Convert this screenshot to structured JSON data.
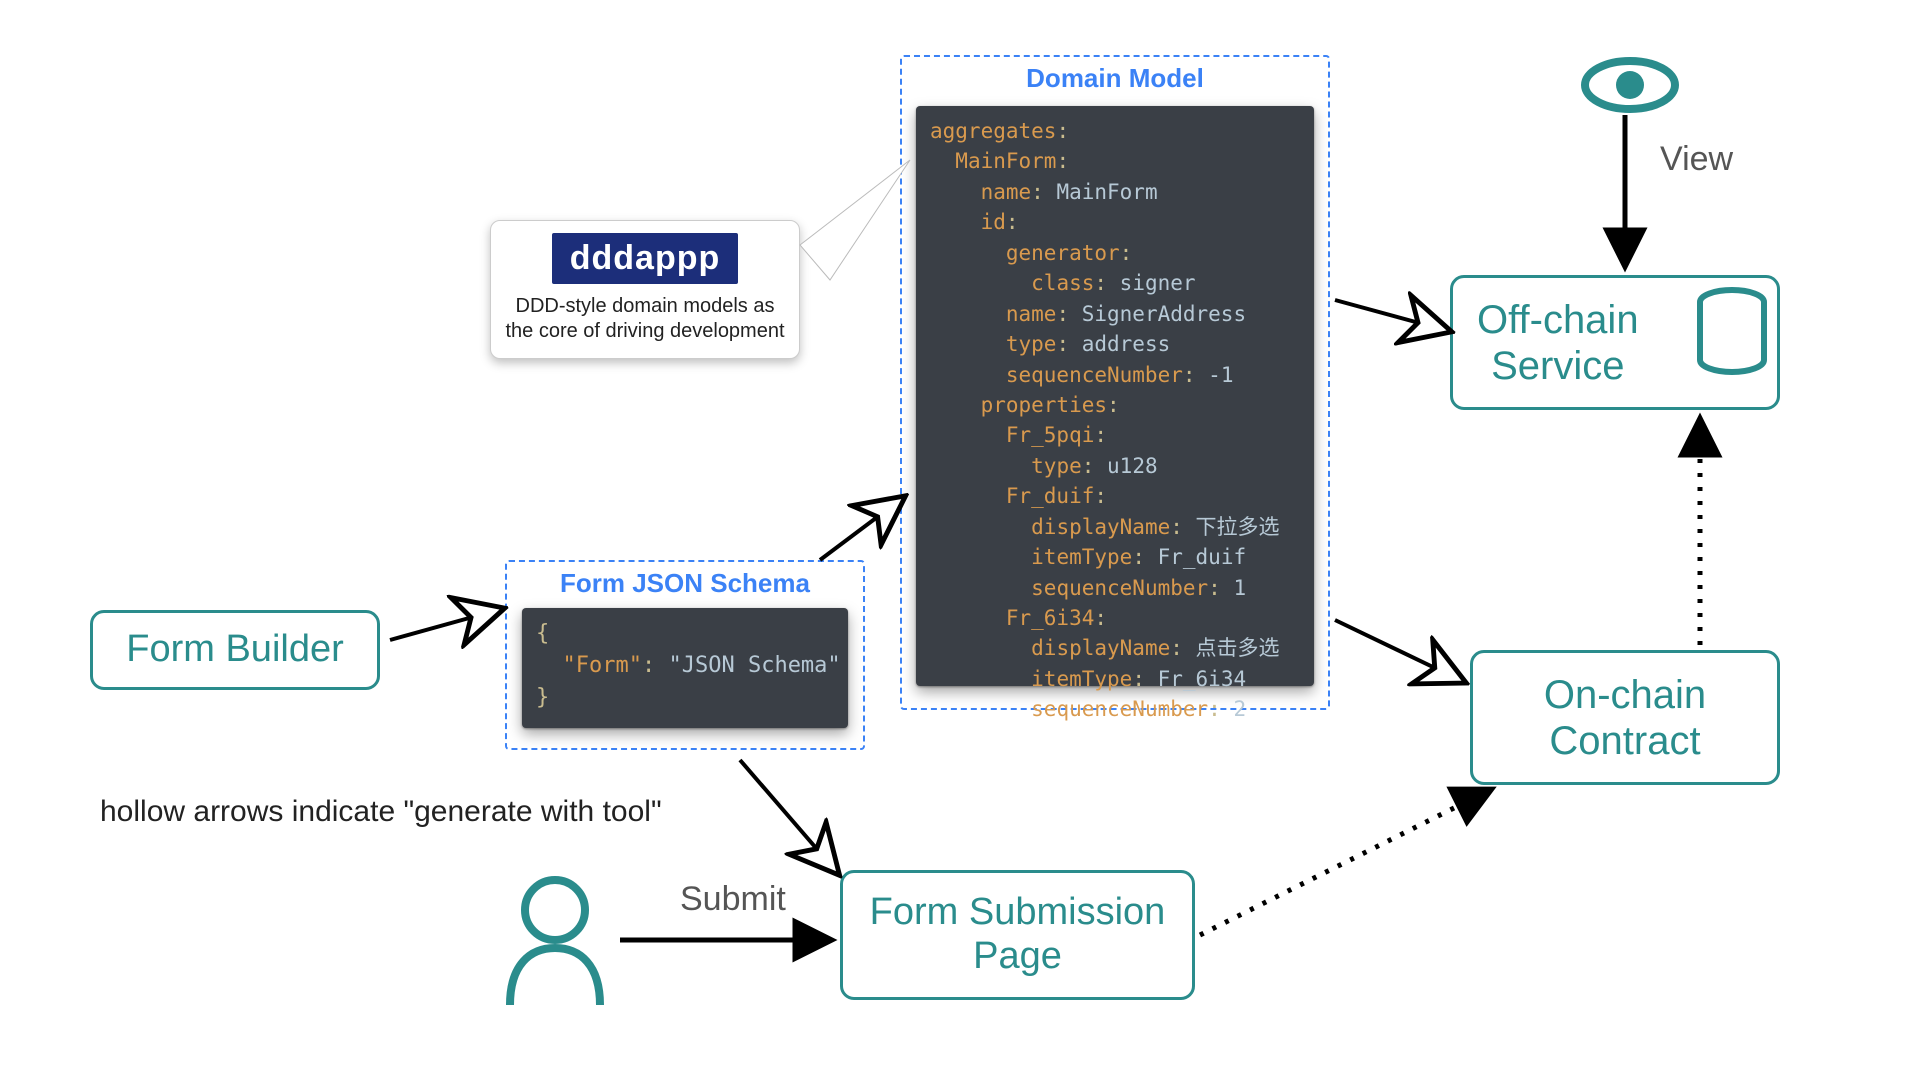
{
  "nodes": {
    "form_builder": "Form Builder",
    "off_chain": "Off-chain\nService",
    "on_chain": "On-chain\nContract",
    "form_submission": "Form Submission\nPage"
  },
  "groups": {
    "schema_title": "Form JSON Schema",
    "domain_title": "Domain Model"
  },
  "dddappp": {
    "logo": "dddappp",
    "subtitle": "DDD-style domain models as the core of driving development"
  },
  "labels": {
    "submit": "Submit",
    "view": "View"
  },
  "caption_hollow": "hollow arrows indicate \"generate with tool\"",
  "code": {
    "schema_raw": "{\n  \"Form\": \"JSON Schema\"\n}",
    "schema": {
      "brace_open": "{",
      "key": "\"Form\"",
      "colon": ": ",
      "value": "\"JSON Schema\"",
      "brace_close": "}"
    },
    "domain_yaml": {
      "l1_k": "aggregates",
      "l1_c": ":",
      "l2_k": "MainForm",
      "l2_c": ":",
      "l3_k": "name",
      "l3_c": ": ",
      "l3_v": "MainForm",
      "l4_k": "id",
      "l4_c": ":",
      "l5_k": "generator",
      "l5_c": ":",
      "l6_k": "class",
      "l6_c": ": ",
      "l6_v": "signer",
      "l7_k": "name",
      "l7_c": ": ",
      "l7_v": "SignerAddress",
      "l8_k": "type",
      "l8_c": ": ",
      "l8_v": "address",
      "l9_k": "sequenceNumber",
      "l9_c": ": ",
      "l9_v": "-1",
      "l10_k": "properties",
      "l10_c": ":",
      "l11_k": "Fr_5pqi",
      "l11_c": ":",
      "l12_k": "type",
      "l12_c": ": ",
      "l12_v": "u128",
      "l13_k": "Fr_duif",
      "l13_c": ":",
      "l14_k": "displayName",
      "l14_c": ": ",
      "l14_v": "下拉多选",
      "l15_k": "itemType",
      "l15_c": ": ",
      "l15_v": "Fr_duif",
      "l16_k": "sequenceNumber",
      "l16_c": ": ",
      "l16_v": "1",
      "l17_k": "Fr_6i34",
      "l17_c": ":",
      "l18_k": "displayName",
      "l18_c": ": ",
      "l18_v": "点击多选",
      "l19_k": "itemType",
      "l19_c": ": ",
      "l19_v": "Fr_6i34",
      "l20_k": "sequenceNumber",
      "l20_c": ": ",
      "l20_v": "2"
    }
  },
  "colors": {
    "teal": "#2a8c8c",
    "blue": "#3b82f6",
    "codebg": "#3a3f46",
    "key": "#d99a4e",
    "val": "#b7c9d6"
  }
}
